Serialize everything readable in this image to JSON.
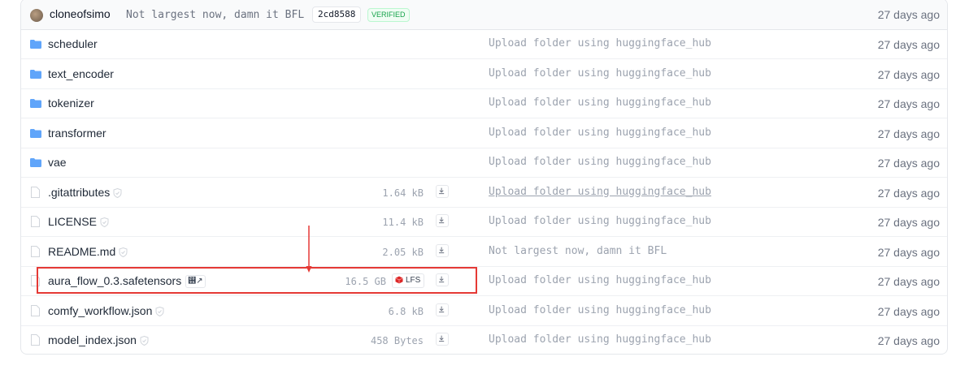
{
  "commit": {
    "author": "cloneofsimo",
    "message": "Not largest now, damn it BFL",
    "sha": "2cd8588",
    "verified_label": "VERIFIED",
    "time": "27 days ago"
  },
  "rows": [
    {
      "type": "folder",
      "name": "scheduler",
      "message": "Upload folder using huggingface_hub",
      "time": "27 days ago"
    },
    {
      "type": "folder",
      "name": "text_encoder",
      "message": "Upload folder using huggingface_hub",
      "time": "27 days ago"
    },
    {
      "type": "folder",
      "name": "tokenizer",
      "message": "Upload folder using huggingface_hub",
      "time": "27 days ago"
    },
    {
      "type": "folder",
      "name": "transformer",
      "message": "Upload folder using huggingface_hub",
      "time": "27 days ago"
    },
    {
      "type": "folder",
      "name": "vae",
      "message": "Upload folder using huggingface_hub",
      "time": "27 days ago"
    },
    {
      "type": "file",
      "name": ".gitattributes",
      "size": "1.64 kB",
      "message": "Upload folder using huggingface_hub",
      "time": "27 days ago"
    },
    {
      "type": "file",
      "name": "LICENSE",
      "size": "11.4 kB",
      "message": "Upload folder using huggingface_hub",
      "time": "27 days ago"
    },
    {
      "type": "file",
      "name": "README.md",
      "size": "2.05 kB",
      "message": "Not largest now, damn it BFL",
      "time": "27 days ago"
    },
    {
      "type": "file",
      "name": "aura_flow_0.3.safetensors",
      "size": "16.5 GB",
      "lfs_label": "LFS",
      "message": "Upload folder using huggingface_hub",
      "time": "27 days ago"
    },
    {
      "type": "file",
      "name": "comfy_workflow.json",
      "size": "6.8 kB",
      "message": "Upload folder using huggingface_hub",
      "time": "27 days ago"
    },
    {
      "type": "file",
      "name": "model_index.json",
      "size": "458 Bytes",
      "message": "Upload folder using huggingface_hub",
      "time": "27 days ago"
    }
  ],
  "icons": {
    "folder": "folder-icon",
    "file": "file-icon",
    "download": "download-icon",
    "safe": "shield-check-icon",
    "lfs": "lfs-icon",
    "xet": "xet-external-link-icon"
  },
  "colors": {
    "folder": "#60a5fa",
    "highlight": "#e53935",
    "verified": "#16a34a",
    "lfs": "#dc2626"
  }
}
